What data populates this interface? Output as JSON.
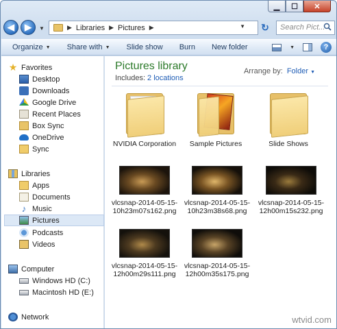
{
  "window": {
    "caption": {
      "minimize": "▁",
      "maximize": "☐",
      "close": "✕"
    }
  },
  "address": {
    "crumbs": [
      "Libraries",
      "Pictures"
    ],
    "search_placeholder": "Search Pict..."
  },
  "toolbar": {
    "organize": "Organize",
    "share_with": "Share with",
    "slide_show": "Slide show",
    "burn": "Burn",
    "new_folder": "New folder",
    "help": "?"
  },
  "nav": {
    "favorites": "Favorites",
    "favorites_items": [
      "Desktop",
      "Downloads",
      "Google Drive",
      "Recent Places",
      "Box Sync",
      "OneDrive",
      "Sync"
    ],
    "libraries": "Libraries",
    "libraries_items": [
      "Apps",
      "Documents",
      "Music",
      "Pictures",
      "Podcasts",
      "Videos"
    ],
    "selected": "Pictures",
    "computer": "Computer",
    "computer_items": [
      "Windows HD (C:)",
      "Macintosh HD (E:)"
    ],
    "network": "Network"
  },
  "content": {
    "title": "Pictures library",
    "includes_label": "Includes:",
    "includes_link": "2 locations",
    "arrange_label": "Arrange by:",
    "arrange_value": "Folder",
    "folders": [
      {
        "label": "NVIDIA Corporation"
      },
      {
        "label": "Sample Pictures"
      },
      {
        "label": "Slide Shows"
      }
    ],
    "files": [
      {
        "label": "vlcsnap-2014-05-15-10h23m07s162.png",
        "colors": [
          "#1c140c",
          "#6a4a22",
          "#c89a55"
        ]
      },
      {
        "label": "vlcsnap-2014-05-15-10h23m38s68.png",
        "colors": [
          "#15100a",
          "#7a5524",
          "#e0b66a"
        ]
      },
      {
        "label": "vlcsnap-2014-05-15-12h00m15s232.png",
        "colors": [
          "#0e0c08",
          "#3a2a16",
          "#9a7a3c"
        ]
      },
      {
        "label": "vlcsnap-2014-05-15-12h00m29s111.png",
        "colors": [
          "#14110c",
          "#4d3a20",
          "#b08a4a"
        ]
      },
      {
        "label": "vlcsnap-2014-05-15-12h00m35s175.png",
        "colors": [
          "#0f0d0a",
          "#5a4426",
          "#c7a468"
        ]
      }
    ]
  },
  "watermark": "wtvid.com"
}
